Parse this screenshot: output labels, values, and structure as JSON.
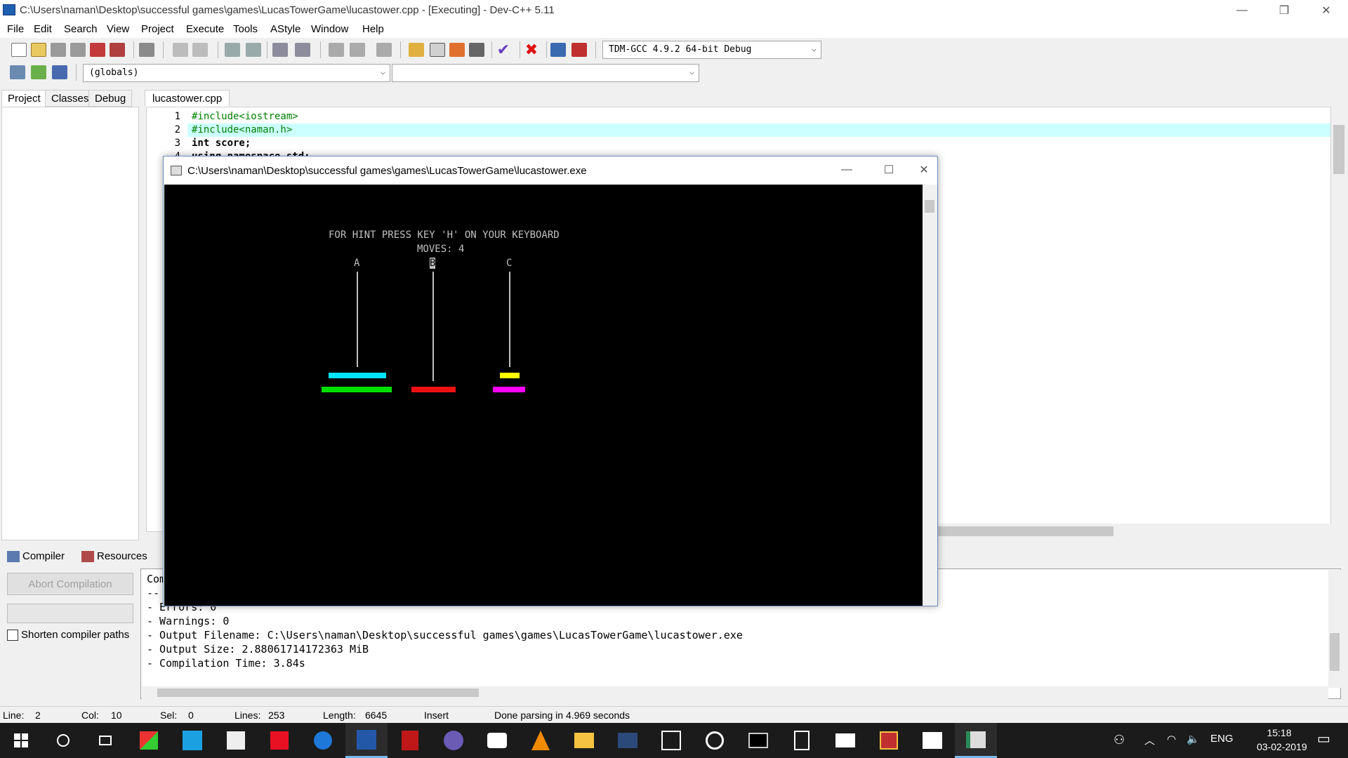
{
  "window": {
    "title": "C:\\Users\\naman\\Desktop\\successful games\\games\\LucasTowerGame\\lucastower.cpp - [Executing] - Dev-C++ 5.11",
    "minimize": "—",
    "restore": "❐",
    "close": "✕"
  },
  "menu": [
    "File",
    "Edit",
    "Search",
    "View",
    "Project",
    "Execute",
    "Tools",
    "AStyle",
    "Window",
    "Help"
  ],
  "toolbar": {
    "compiler_select": "TDM-GCC 4.9.2 64-bit Debug",
    "scope_select": "(globals)",
    "member_select": ""
  },
  "left_tabs": [
    "Project",
    "Classes",
    "Debug"
  ],
  "editor": {
    "tab": "lucastower.cpp",
    "lines": [
      {
        "n": "1",
        "code": "#include<iostream>"
      },
      {
        "n": "2",
        "code": "#include<naman.h>"
      },
      {
        "n": "3",
        "code": "int score;"
      },
      {
        "n": "4",
        "code": "using namespace std;"
      }
    ],
    "gutter_partial": [
      "1",
      "1",
      "1",
      "1",
      "1",
      "1",
      "1",
      "1",
      "1",
      "1",
      "2",
      "2",
      "2",
      "2",
      "2",
      "2",
      "2",
      "2",
      "2",
      "2",
      "3",
      "3"
    ]
  },
  "bottom_tabs": [
    "Compiler",
    "Resources"
  ],
  "compiler_panel": {
    "abort_button": "Abort Compilation",
    "shorten_paths_label": "Shorten compiler paths",
    "output_lines": [
      "Com",
      "--",
      "- Errors: 0",
      "- Warnings: 0",
      "- Output Filename: C:\\Users\\naman\\Desktop\\successful games\\games\\LucasTowerGame\\lucastower.exe",
      "- Output Size: 2.88061714172363 MiB",
      "- Compilation Time: 3.84s"
    ]
  },
  "status": {
    "line_label": "Line:",
    "line_value": "2",
    "col_label": "Col:",
    "col_value": "10",
    "sel_label": "Sel:",
    "sel_value": "0",
    "lines_label": "Lines:",
    "lines_value": "253",
    "length_label": "Length:",
    "length_value": "6645",
    "mode": "Insert",
    "message": "Done parsing in 4.969 seconds"
  },
  "console": {
    "title": "C:\\Users\\naman\\Desktop\\successful games\\games\\LucasTowerGame\\lucastower.exe",
    "hint": "FOR HINT PRESS KEY 'H' ON YOUR KEYBOARD",
    "moves": "MOVES: 4",
    "peg_labels": [
      "A",
      "B",
      "C"
    ],
    "selected_peg": "B",
    "disk_colors": {
      "cyan": "#00e5ff",
      "green": "#00e000",
      "red": "#ee1111",
      "yellow": "#ffff00",
      "magenta": "#ff00ff"
    }
  },
  "taskbar": {
    "language": "ENG",
    "time": "15:18",
    "date": "03-02-2019"
  }
}
